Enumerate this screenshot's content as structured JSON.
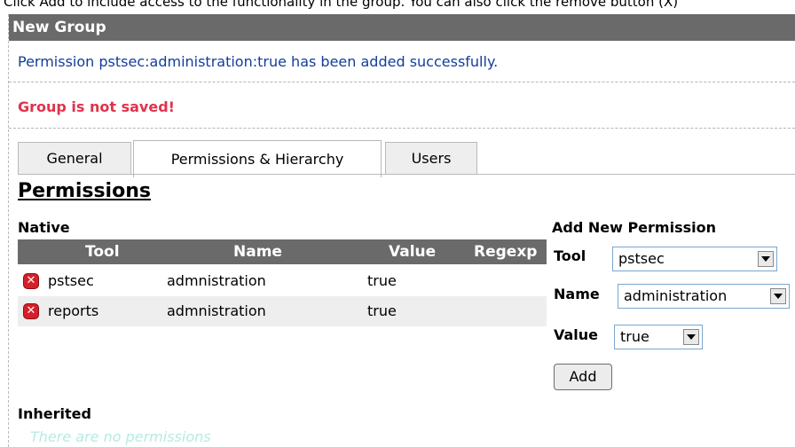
{
  "caption": "Click Add to include access to the functionality in the group. You can also click the remove button (X)",
  "window": {
    "title": "New Group"
  },
  "messages": {
    "success": "Permission pstsec:administration:true has been added successfully.",
    "error": "Group is not saved!"
  },
  "tabs": [
    {
      "label": "General"
    },
    {
      "label": "Permissions & Hierarchy"
    },
    {
      "label": "Users"
    }
  ],
  "section": {
    "title": "Permissions",
    "native_label": "Native",
    "inherited_label": "Inherited",
    "inherited_empty": "There are no permissions"
  },
  "table": {
    "headers": {
      "tool": "Tool",
      "name": "Name",
      "value": "Value",
      "regexp": "Regexp"
    },
    "rows": [
      {
        "tool": "pstsec",
        "name": "admnistration",
        "value": "true"
      },
      {
        "tool": "reports",
        "name": "admnistration",
        "value": "true"
      }
    ]
  },
  "add_form": {
    "title": "Add New Permission",
    "tool_label": "Tool",
    "tool_value": "pstsec",
    "name_label": "Name",
    "name_value": "administration",
    "value_label": "Value",
    "value_value": "true",
    "add_label": "Add"
  },
  "colors": {
    "title_bar": "#6a6a6a",
    "success": "#123d9b",
    "error": "#e0334b",
    "remove": "#d4202b",
    "empty_text": "#b5ebe2"
  }
}
